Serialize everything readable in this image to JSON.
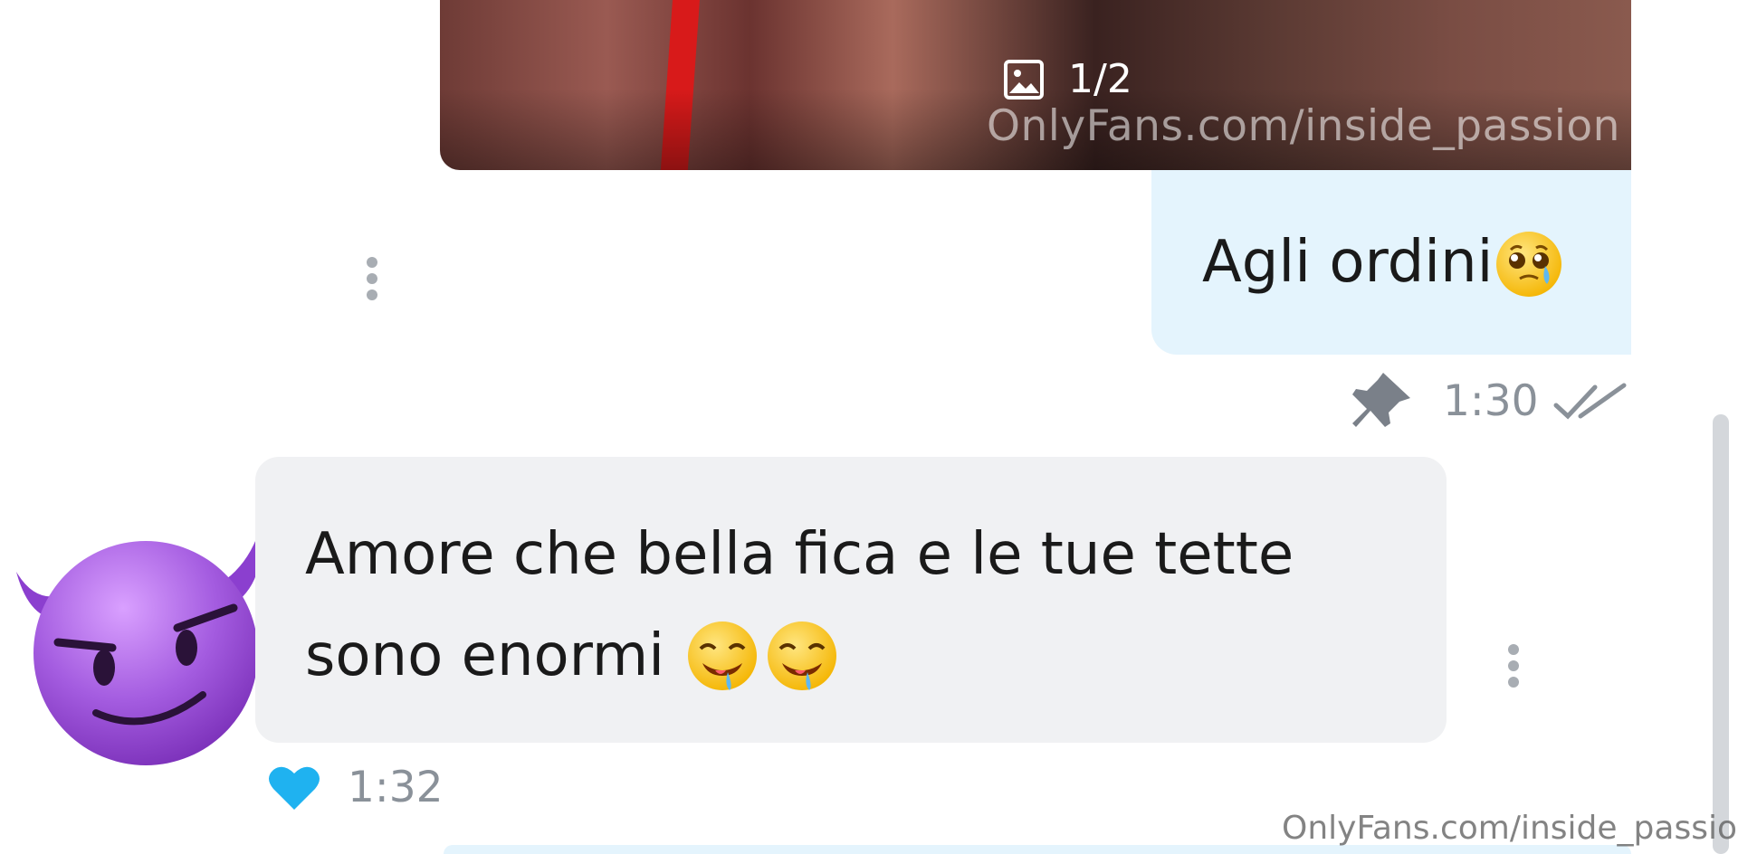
{
  "media": {
    "counter": "1/2",
    "watermark": "OnlyFans.com/inside_passion",
    "icon": "image-icon"
  },
  "sent_message": {
    "text": "Agli ordini",
    "emoji": "crying-face",
    "time": "1:30",
    "pin_icon": "pin-icon",
    "status_icon": "double-check-icon"
  },
  "received_message": {
    "line1": "Amore che bella fica e le tue tette",
    "line2": "sono enormi",
    "emoji": "drooling-face",
    "time": "1:32",
    "like_icon": "heart-icon",
    "avatar": "smiling-devil-emoji"
  },
  "watermark_bottom": "OnlyFans.com/inside_passion",
  "colors": {
    "sent_bubble": "#e4f4fd",
    "received_bubble": "#f0f1f3",
    "heart": "#1fb2f0",
    "avatar": "#9b4fd6",
    "meta_text": "#8a9199"
  }
}
